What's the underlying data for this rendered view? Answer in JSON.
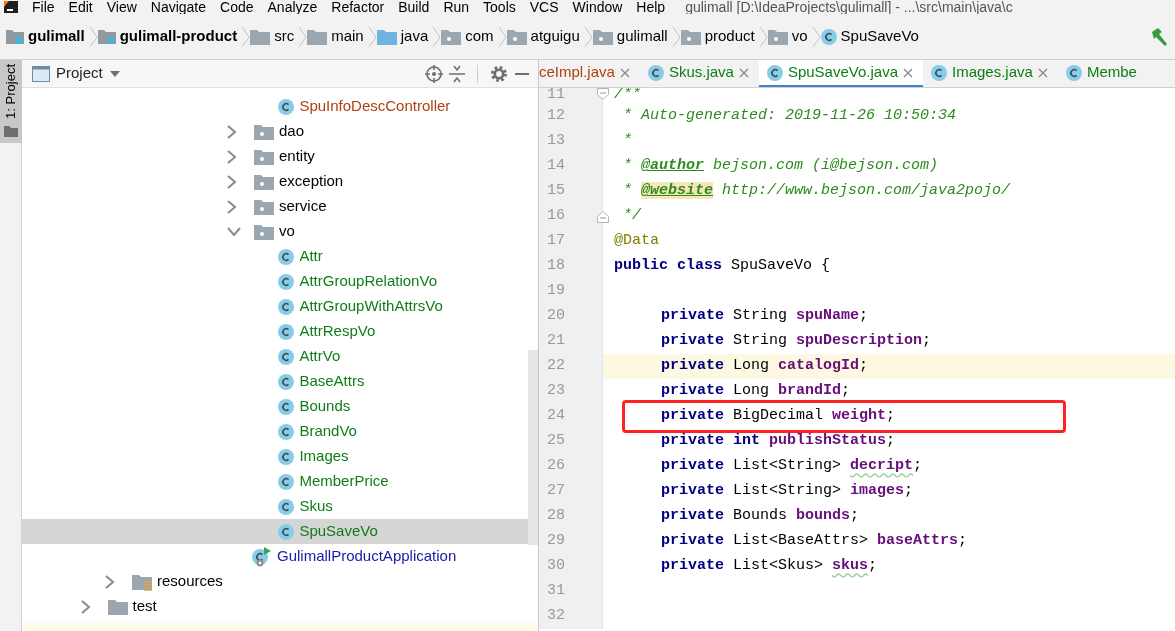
{
  "window": {
    "title": "gulimall [D:\\IdeaProjects\\gulimall] - ...\\src\\main\\java\\c"
  },
  "menu": [
    "File",
    "Edit",
    "View",
    "Navigate",
    "Code",
    "Analyze",
    "Refactor",
    "Build",
    "Run",
    "Tools",
    "VCS",
    "Window",
    "Help"
  ],
  "breadcrumbs": [
    {
      "kind": "module",
      "label": "gulimall"
    },
    {
      "kind": "module",
      "label": "gulimall-product"
    },
    {
      "kind": "folder",
      "label": "src"
    },
    {
      "kind": "folder",
      "label": "main"
    },
    {
      "kind": "source",
      "label": "java"
    },
    {
      "kind": "package",
      "label": "com"
    },
    {
      "kind": "package",
      "label": "atguigu"
    },
    {
      "kind": "package",
      "label": "gulimall"
    },
    {
      "kind": "package",
      "label": "product"
    },
    {
      "kind": "package",
      "label": "vo"
    },
    {
      "kind": "class",
      "label": "SpuSaveVo"
    }
  ],
  "side_strip": {
    "label": "1: Project"
  },
  "project_panel": {
    "title": "Project",
    "tree": [
      {
        "children": [
          {
            "children": [
              {
                "children": [
                  {
                    "children": [
                      {
                        "children": [
                          {
                            "children": [
                              {
                                "children": [
                                  {
                                    "kind": "class",
                                    "label": "SpuInfoDescController",
                                    "color": "#b0400f",
                                    "selected": false
                                  }
                                ]
                              },
                              {
                                "kind": "package",
                                "label": "dao",
                                "expanded": false,
                                "selected": false
                              },
                              {
                                "kind": "package",
                                "label": "entity",
                                "expanded": false,
                                "selected": false
                              },
                              {
                                "kind": "package",
                                "label": "exception",
                                "expanded": false,
                                "selected": false
                              },
                              {
                                "kind": "package",
                                "label": "service",
                                "expanded": false,
                                "selected": false
                              },
                              {
                                "kind": "package",
                                "label": "vo",
                                "expanded": true,
                                "selected": false,
                                "children": [
                                  {
                                    "kind": "class",
                                    "label": "Attr",
                                    "color": "#0f7d15",
                                    "selected": false
                                  },
                                  {
                                    "kind": "class",
                                    "label": "AttrGroupRelationVo",
                                    "color": "#0f7d15",
                                    "selected": false
                                  },
                                  {
                                    "kind": "class",
                                    "label": "AttrGroupWithAttrsVo",
                                    "color": "#0f7d15",
                                    "selected": false
                                  },
                                  {
                                    "kind": "class",
                                    "label": "AttrRespVo",
                                    "color": "#0f7d15",
                                    "selected": false
                                  },
                                  {
                                    "kind": "class",
                                    "label": "AttrVo",
                                    "color": "#0f7d15",
                                    "selected": false
                                  },
                                  {
                                    "kind": "class",
                                    "label": "BaseAttrs",
                                    "color": "#0f7d15",
                                    "selected": false
                                  },
                                  {
                                    "kind": "class",
                                    "label": "Bounds",
                                    "color": "#0f7d15",
                                    "selected": false
                                  },
                                  {
                                    "kind": "class",
                                    "label": "BrandVo",
                                    "color": "#0f7d15",
                                    "selected": false
                                  },
                                  {
                                    "kind": "class",
                                    "label": "Images",
                                    "color": "#0f7d15",
                                    "selected": false
                                  },
                                  {
                                    "kind": "class",
                                    "label": "MemberPrice",
                                    "color": "#0f7d15",
                                    "selected": false
                                  },
                                  {
                                    "kind": "class",
                                    "label": "Skus",
                                    "color": "#0f7d15",
                                    "selected": false
                                  },
                                  {
                                    "kind": "class",
                                    "label": "SpuSaveVo",
                                    "color": "#0f7d15",
                                    "selected": true
                                  }
                                ]
                              },
                              {
                                "kind": "app",
                                "label": "GulimallProductApplication",
                                "color": "#1a1aa6",
                                "selected": false
                              }
                            ]
                          }
                        ]
                      }
                    ]
                  }
                ]
              }
            ]
          },
          {
            "kind": "resources",
            "label": "resources",
            "expanded": false,
            "selected": false
          }
        ]
      },
      {
        "kind": "folder",
        "label": "test",
        "expanded": false,
        "selected": false
      }
    ]
  },
  "tabs": [
    {
      "label": "ceImpl.java",
      "color": "#b0400f",
      "icon": false,
      "selected": false
    },
    {
      "label": "Skus.java",
      "color": "#0f7d15",
      "icon": true,
      "selected": false
    },
    {
      "label": "SpuSaveVo.java",
      "color": "#0f7d15",
      "icon": true,
      "selected": true
    },
    {
      "label": "Images.java",
      "color": "#0f7d15",
      "icon": true,
      "selected": false
    },
    {
      "label": "Membe",
      "color": "#0f7d15",
      "icon": true,
      "selected": false
    }
  ],
  "editor": {
    "lines": [
      {
        "number": "11",
        "fold_start": true,
        "current": false,
        "boxed": false,
        "tokens": [
          {
            "kind": "comment",
            "text": "/**"
          }
        ]
      },
      {
        "number": "12",
        "current": false,
        "boxed": false,
        "tokens": [
          {
            "kind": "comment",
            "text": " * Auto-generated: 2019-11-26 10:50:34"
          }
        ]
      },
      {
        "number": "13",
        "current": false,
        "boxed": false,
        "tokens": [
          {
            "kind": "comment",
            "text": " *"
          }
        ]
      },
      {
        "number": "14",
        "current": false,
        "boxed": false,
        "tokens": [
          {
            "kind": "comment",
            "text": " * "
          },
          {
            "kind": "doc-tag",
            "text": "@author"
          },
          {
            "kind": "comment",
            "text": " bejson.com (i@bejson.com)"
          }
        ]
      },
      {
        "number": "15",
        "current": false,
        "boxed": false,
        "tokens": [
          {
            "kind": "comment",
            "text": " * "
          },
          {
            "kind": "marked-doc-tag",
            "text": "@website"
          },
          {
            "kind": "comment",
            "text": " http://www.bejson.com/java2pojo/"
          }
        ]
      },
      {
        "number": "16",
        "fold_end": true,
        "current": false,
        "boxed": false,
        "tokens": [
          {
            "kind": "comment",
            "text": " */"
          }
        ]
      },
      {
        "number": "17",
        "current": false,
        "boxed": false,
        "tokens": [
          {
            "kind": "annotation",
            "text": "@Data"
          }
        ]
      },
      {
        "number": "18",
        "current": false,
        "boxed": false,
        "tokens": [
          {
            "kind": "keyword",
            "text": "public class"
          },
          {
            "kind": "plain",
            "text": " SpuSaveVo {"
          }
        ]
      },
      {
        "number": "19",
        "current": false,
        "boxed": false
      },
      {
        "number": "20",
        "kind": "member",
        "current": false,
        "boxed": false,
        "tokens": [
          {
            "kind": "keyword",
            "text": "private"
          },
          {
            "kind": "plain",
            "text": " String "
          },
          {
            "kind": "field",
            "text": "spuName"
          },
          {
            "kind": "plain",
            "text": ";"
          }
        ]
      },
      {
        "number": "21",
        "kind": "member",
        "current": false,
        "boxed": false,
        "tokens": [
          {
            "kind": "keyword",
            "text": "private"
          },
          {
            "kind": "plain",
            "text": " String "
          },
          {
            "kind": "field",
            "text": "spuDescription"
          },
          {
            "kind": "plain",
            "text": ";"
          }
        ]
      },
      {
        "number": "22",
        "kind": "member",
        "current": true,
        "boxed": false,
        "tokens": [
          {
            "kind": "keyword",
            "text": "private"
          },
          {
            "kind": "plain",
            "text": " Long "
          },
          {
            "kind": "field",
            "text": "catalogId"
          },
          {
            "kind": "plain",
            "text": ";"
          }
        ]
      },
      {
        "number": "23",
        "kind": "member",
        "current": false,
        "boxed": false,
        "tokens": [
          {
            "kind": "keyword",
            "text": "private"
          },
          {
            "kind": "plain",
            "text": " Long "
          },
          {
            "kind": "field",
            "text": "brandId"
          },
          {
            "kind": "plain",
            "text": ";"
          }
        ]
      },
      {
        "number": "24",
        "kind": "member",
        "current": false,
        "boxed": true,
        "tokens": [
          {
            "kind": "keyword",
            "text": "private"
          },
          {
            "kind": "plain",
            "text": " BigDecimal "
          },
          {
            "kind": "field",
            "text": "weight"
          },
          {
            "kind": "plain",
            "text": ";"
          }
        ]
      },
      {
        "number": "25",
        "kind": "member",
        "current": false,
        "boxed": false,
        "tokens": [
          {
            "kind": "keyword",
            "text": "private int"
          },
          {
            "kind": "field",
            "text": " publishStatus"
          },
          {
            "kind": "plain",
            "text": ";"
          }
        ]
      },
      {
        "number": "26",
        "kind": "member",
        "current": false,
        "boxed": false,
        "tokens": [
          {
            "kind": "keyword",
            "text": "private"
          },
          {
            "kind": "plain",
            "text": " List<String> "
          },
          {
            "kind": "flagged-field",
            "text": "decript"
          },
          {
            "kind": "plain",
            "text": ";"
          }
        ]
      },
      {
        "number": "27",
        "kind": "member",
        "current": false,
        "boxed": false,
        "tokens": [
          {
            "kind": "keyword",
            "text": "private"
          },
          {
            "kind": "plain",
            "text": " List<String> "
          },
          {
            "kind": "field",
            "text": "images"
          },
          {
            "kind": "plain",
            "text": ";"
          }
        ]
      },
      {
        "number": "28",
        "kind": "member",
        "current": false,
        "boxed": false,
        "tokens": [
          {
            "kind": "keyword",
            "text": "private"
          },
          {
            "kind": "plain",
            "text": " Bounds "
          },
          {
            "kind": "field",
            "text": "bounds"
          },
          {
            "kind": "plain",
            "text": ";"
          }
        ]
      },
      {
        "number": "29",
        "kind": "member",
        "current": false,
        "boxed": false,
        "tokens": [
          {
            "kind": "keyword",
            "text": "private"
          },
          {
            "kind": "plain",
            "text": " List<BaseAttrs> "
          },
          {
            "kind": "field",
            "text": "baseAttrs"
          },
          {
            "kind": "plain",
            "text": ";"
          }
        ]
      },
      {
        "number": "30",
        "kind": "member",
        "current": false,
        "boxed": false,
        "tokens": [
          {
            "kind": "keyword",
            "text": "private"
          },
          {
            "kind": "plain",
            "text": " List<Skus> "
          },
          {
            "kind": "flagged-field",
            "text": "skus"
          },
          {
            "kind": "plain",
            "text": ";"
          }
        ]
      },
      {
        "number": "31",
        "current": false,
        "boxed": false
      },
      {
        "number": "32",
        "current": false,
        "boxed": false
      }
    ]
  }
}
